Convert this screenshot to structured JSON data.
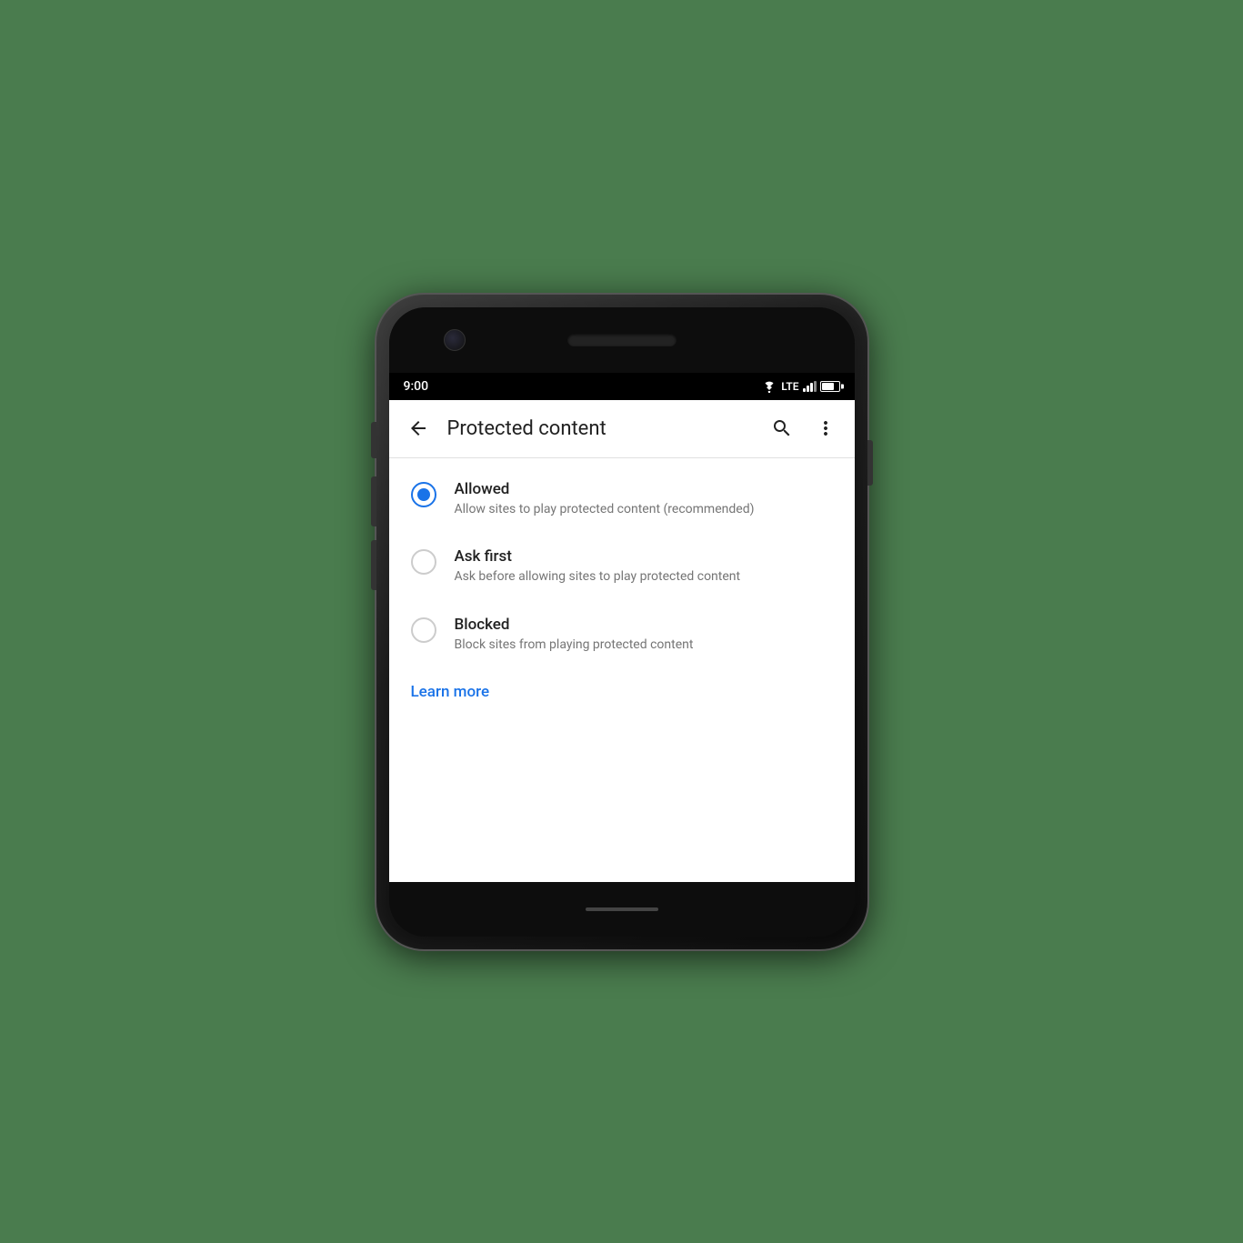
{
  "status": {
    "time": "9:00",
    "lte": "LTE"
  },
  "appbar": {
    "title": "Protected content",
    "back_label": "Back",
    "search_label": "Search",
    "more_label": "More options"
  },
  "options": [
    {
      "id": "allowed",
      "title": "Allowed",
      "description": "Allow sites to play protected content (recommended)",
      "selected": true
    },
    {
      "id": "ask-first",
      "title": "Ask first",
      "description": "Ask before allowing sites to play protected content",
      "selected": false
    },
    {
      "id": "blocked",
      "title": "Blocked",
      "description": "Block sites from playing protected content",
      "selected": false
    }
  ],
  "learn_more": {
    "label": "Learn more"
  }
}
